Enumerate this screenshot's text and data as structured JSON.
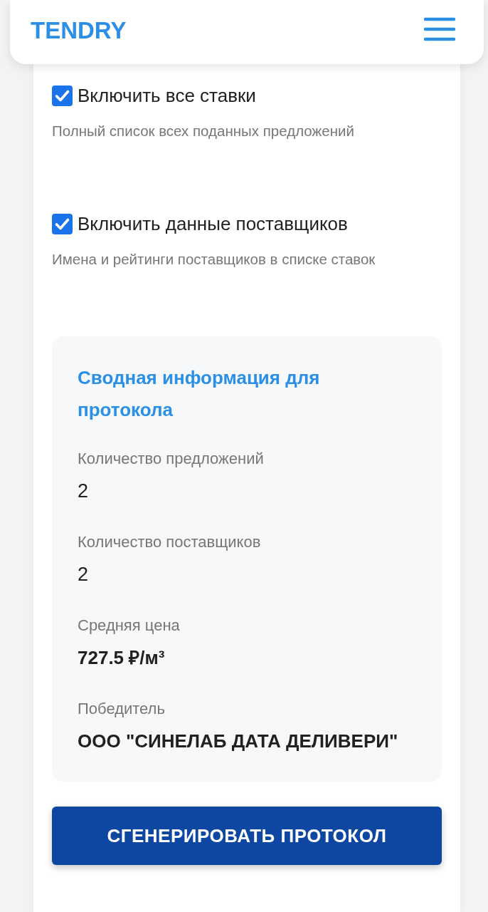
{
  "header": {
    "logo": "TENDRY"
  },
  "options": [
    {
      "label": "Включить все ставки",
      "description": "Полный список всех поданных предложений",
      "checked": true
    },
    {
      "label": "Включить данные поставщиков",
      "description": "Имена и рейтинги поставщиков в списке ставок",
      "checked": true
    }
  ],
  "summary": {
    "title": "Сводная информация для протокола",
    "items": [
      {
        "label": "Количество предложений",
        "value": "2",
        "kind": "plain"
      },
      {
        "label": "Количество поставщиков",
        "value": "2",
        "kind": "plain"
      },
      {
        "label": "Средняя цена",
        "value": "727.5 ₽/м³",
        "kind": "strong"
      },
      {
        "label": "Победитель",
        "value": "ООО \"СИНЕЛАБ ДАТА ДЕЛИВЕРИ\"",
        "kind": "strong"
      }
    ]
  },
  "button": {
    "label": "СГЕНЕРИРОВАТЬ ПРОТОКОЛ"
  }
}
